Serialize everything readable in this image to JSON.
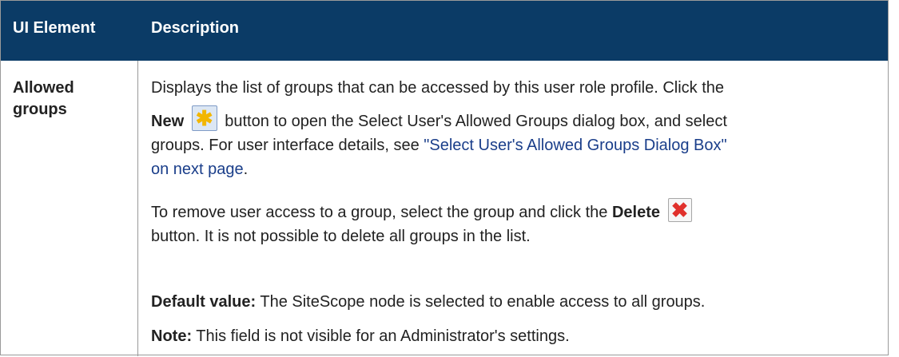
{
  "table": {
    "headers": [
      "UI Element",
      "Description"
    ],
    "row": {
      "element_line1": "Allowed",
      "element_line2": "groups",
      "p1_line1": "Displays the list of groups that can be accessed by this user role profile. Click the",
      "p1_new_label": "New",
      "p1_line2_rest": "button to open the Select User's Allowed Groups dialog box, and select",
      "p1_line3": "groups. For user interface details, see ",
      "p1_link_line1": "\"Select User's Allowed Groups Dialog Box\"",
      "p1_link_line2": "on next page",
      "p1_end": ".",
      "p2_line1": "To remove user access to a group, select the group and click the ",
      "p2_delete_label": "Delete",
      "p2_line2": "button. It is not possible to delete all groups in the list.",
      "default_label": "Default value:",
      "default_text": " The SiteScope node is selected to enable access to all groups.",
      "note_label": "Note:",
      "note_text": " This field is not visible for an Administrator's settings."
    }
  },
  "icons": {
    "new": "new-star-icon",
    "delete": "delete-x-icon"
  },
  "colors": {
    "header_bg": "#0b3b66",
    "link": "#1a3e8a",
    "new_star": "#f2b600",
    "delete_x": "#e0302b"
  }
}
